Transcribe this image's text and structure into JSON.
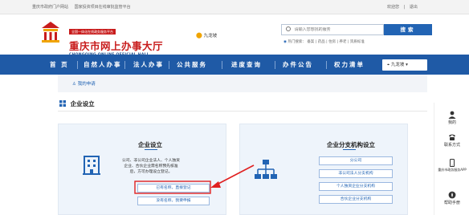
{
  "topbar": {
    "links": [
      "重庆市政府门户网站",
      "国家投资项目在线审批监管平台"
    ],
    "user": [
      "欢迎您",
      "|",
      "退出"
    ]
  },
  "header": {
    "tag": "全国一体化在线政务服务平台",
    "title": "重庆市网上办事大厅",
    "subtitle": "CHONGQING ONLINE OFFICIAL HALL",
    "location": "九龙坡",
    "search_placeholder": "请输入您想找的服务",
    "search_button": "搜索",
    "hot_label": "热门搜索：",
    "hot_items": "备案 | 药品 | 住房 | 养老 | 资质标准"
  },
  "nav": {
    "items": [
      "首 页",
      "自然人办事",
      "法人办事",
      "公共服务",
      "进度查询",
      "办件公告",
      "权力清单"
    ],
    "location_select": "九龙坡"
  },
  "breadcrumb": "我的申请",
  "section_title": "企业设立",
  "cards": [
    {
      "title": "企业设立",
      "description": "公司、非公司企业法人、个人独资企业、合伙企业需名称预先核准后，方可办理设立登记。",
      "buttons": [
        "已有名称，直接登记",
        "没有名称，我要申报"
      ]
    },
    {
      "title": "企业分支机构设立",
      "buttons": [
        "分公司",
        "非公司法人分支机构",
        "个人独资企业分支机构",
        "合伙企业分支机构"
      ]
    }
  ],
  "side_panel": [
    {
      "icon": "user-icon",
      "label": "我的"
    },
    {
      "icon": "phone-icon",
      "label": "联系方式"
    },
    {
      "icon": "mobile-icon",
      "label": "重庆市政务服务APP"
    },
    {
      "icon": "compass-icon",
      "label": "帮助手册"
    }
  ],
  "colors": {
    "brand_blue": "#1f5aa6",
    "brand_red": "#c81c1c",
    "annotation_red": "#e02020"
  }
}
